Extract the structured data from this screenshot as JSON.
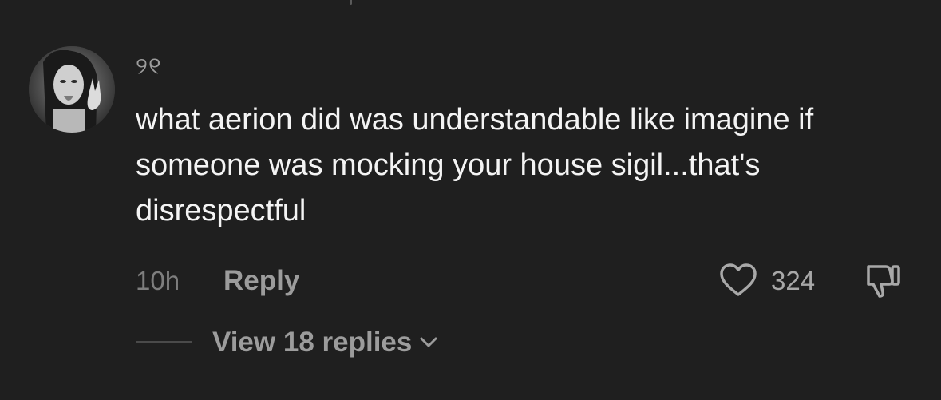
{
  "comment": {
    "username": "୨୧",
    "text": "what aerion did was understandable like imagine if someone was mocking your house sigil...that's disrespectful",
    "timestamp": "10h",
    "reply_label": "Reply",
    "like_count": "324",
    "view_replies_label": "View 18 replies"
  },
  "icons": {
    "like": "heart-outline-icon",
    "dislike": "thumbs-down-icon",
    "expand": "chevron-down-icon"
  },
  "colors": {
    "background": "#1f1f1f",
    "primary_text": "#f4f4f4",
    "secondary_text": "#9c9c9c"
  }
}
